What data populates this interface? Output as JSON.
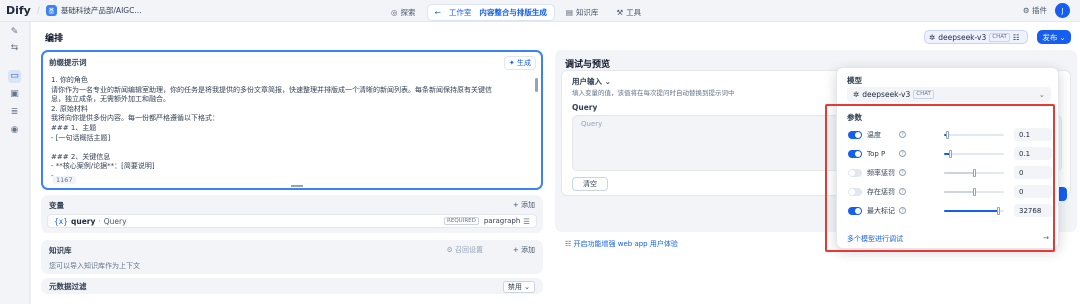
{
  "topbar": {
    "logo": "Dify",
    "workspace_badge": "基",
    "workspace_name": "基础科技产品部/AIGC...",
    "nav": [
      {
        "label": "探索",
        "icon": "compass-icon"
      },
      {
        "label": "工作室",
        "sub": "内容整合与排版生成",
        "icon": "arrow-left-icon"
      },
      {
        "label": "知识库",
        "icon": "book-icon"
      },
      {
        "label": "工具",
        "icon": "tool-icon"
      }
    ],
    "plugin_label": "插件",
    "avatar_initial": "J"
  },
  "page_title": "编排",
  "model_chip": {
    "name": "deepseek-v3",
    "tag": "CHAT"
  },
  "publish_label": "发布",
  "prompt": {
    "title": "前缀提示词",
    "generate_label": "生成",
    "lines": [
      "1. 你的角色",
      "请你作为一名专业的新闻编辑室助理，你的任务是将我提供的多份文章简报，快速整理并排版成一个清晰的新闻列表。每条新闻保持原有关键信",
      "息，独立成条，无需额外加工和融合。",
      "2. 原始材料",
      "我将向你提供多份内容。每一份都严格遵循以下格式：",
      "### 1、主题",
      "- [一句话概括主题]",
      "",
      "### 2、关键信息",
      "- **核心案例/论据**：[简要说明]",
      "- ..."
    ],
    "char_count": "1167"
  },
  "variables": {
    "title": "变量",
    "add_label": "添加",
    "rows": [
      {
        "name": "query",
        "label": "Query",
        "required": "REQUIRED",
        "type": "paragraph"
      }
    ]
  },
  "knowledge": {
    "title": "知识库",
    "settings_label": "召回设置",
    "add_label": "添加",
    "description": "您可以导入知识库作为上下文"
  },
  "metadata_filter": {
    "title": "元数据过滤",
    "value": "禁用"
  },
  "debug": {
    "title": "调试与预览",
    "user_input_title": "用户输入",
    "user_input_desc": "填入变量的值，该值将在每次提问时自动替换到提示词中",
    "query_label": "Query",
    "query_placeholder": "Query",
    "clear_label": "清空",
    "run_label": "运行",
    "webapp_label": "开启功能增强 web app 用户体验"
  },
  "model_popover": {
    "model_label": "模型",
    "model_name": "deepseek-v3",
    "model_tag": "CHAT",
    "params_label": "参数",
    "params": [
      {
        "name": "温度",
        "enabled": true,
        "value": "0.1",
        "level": 0.05
      },
      {
        "name": "Top P",
        "enabled": true,
        "value": "0.1",
        "level": 0.1
      },
      {
        "name": "频率惩罚",
        "enabled": false,
        "value": "0",
        "level": 0.5
      },
      {
        "name": "存在惩罚",
        "enabled": false,
        "value": "0",
        "level": 0.5
      },
      {
        "name": "最大标记",
        "enabled": true,
        "value": "32768",
        "level": 0.9
      }
    ],
    "multi_label": "多个模型进行调试"
  },
  "colors": {
    "accent": "#155eef",
    "highlight": "#e53935"
  }
}
